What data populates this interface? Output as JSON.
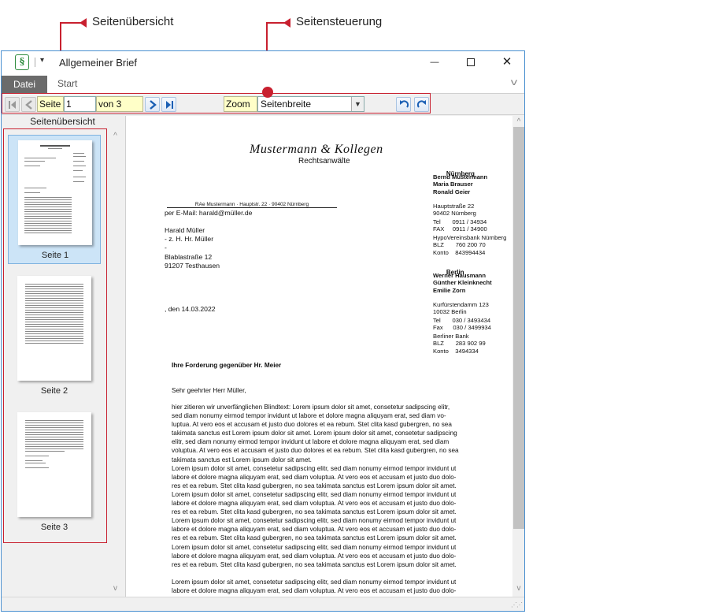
{
  "callouts": {
    "thumbnails_label": "Seitenübersicht",
    "navigation_label": "Seitensteuerung"
  },
  "window": {
    "title": "Allgemeiner Brief",
    "app_icon_glyph": "§",
    "qa_dropdown_glyph": "▾",
    "minimize_glyph": "—",
    "close_glyph": "✕"
  },
  "ribbon": {
    "tabs": [
      "Datei",
      "Start"
    ],
    "collapse_glyph": "v"
  },
  "toolbar": {
    "page_label": "Seite",
    "page_value": "1",
    "page_total": "von 3",
    "zoom_label": "Zoom",
    "zoom_value": "Seitenbreite",
    "dropdown_glyph": "▼"
  },
  "thumbnails": {
    "panel_title": "Seitenübersicht",
    "pages": [
      {
        "label": "Seite 1",
        "selected": true
      },
      {
        "label": "Seite 2",
        "selected": false
      },
      {
        "label": "Seite 3",
        "selected": false
      }
    ]
  },
  "scroll_glyphs": {
    "up": "^",
    "down": "v"
  },
  "letter": {
    "firm_name": "Mustermann & Kollegen",
    "firm_subtitle": "Rechtsanwälte",
    "return_address": "RAe Mustermann · Hauptstr. 22 · 90402 Nürnberg",
    "delivery": "per E-Mail: harald@müller.de",
    "recipient": "Harald Müller\n- z. H. Hr. Müller\n-\nBlablastraße 12\n91207 Testhausen",
    "date_line": ", den 14.03.2022",
    "subject": "Ihre Forderung gegenüber Hr. Meier",
    "salutation": "Sehr geehrter Herr Müller,",
    "body_1": "hier zitieren wir unverfänglichen Blindtext: Lorem ipsum dolor sit amet, consetetur sadipscing elitr,\nsed diam nonumy eirmod tempor invidunt ut labore et dolore magna aliquyam erat, sed diam vo-\nluptua. At vero eos et accusam et justo duo dolores et ea rebum. Stet clita kasd gubergren, no sea\ntakimata sanctus est Lorem ipsum dolor sit amet. Lorem ipsum dolor sit amet, consetetur sadipscing\nelitr, sed diam nonumy eirmod tempor invidunt ut labore et dolore magna aliquyam erat, sed diam\nvoluptua. At vero eos et accusam et justo duo dolores et ea rebum. Stet clita kasd gubergren, no sea\ntakimata sanctus est Lorem ipsum dolor sit amet.\nLorem ipsum dolor sit amet, consetetur sadipscing elitr, sed diam nonumy eirmod tempor invidunt ut\nlabore et dolore magna aliquyam erat, sed diam voluptua. At vero eos et accusam et justo duo dolo-\nres et ea rebum. Stet clita kasd gubergren, no sea takimata sanctus est Lorem ipsum dolor sit amet.\nLorem ipsum dolor sit amet, consetetur sadipscing elitr, sed diam nonumy eirmod tempor invidunt ut\nlabore et dolore magna aliquyam erat, sed diam voluptua. At vero eos et accusam et justo duo dolo-\nres et ea rebum. Stet clita kasd gubergren, no sea takimata sanctus est Lorem ipsum dolor sit amet.\nLorem ipsum dolor sit amet, consetetur sadipscing elitr, sed diam nonumy eirmod tempor invidunt ut\nlabore et dolore magna aliquyam erat, sed diam voluptua. At vero eos et accusam et justo duo dolo-\nres et ea rebum. Stet clita kasd gubergren, no sea takimata sanctus est Lorem ipsum dolor sit amet.\nLorem ipsum dolor sit amet, consetetur sadipscing elitr, sed diam nonumy eirmod tempor invidunt ut\nlabore et dolore magna aliquyam erat, sed diam voluptua. At vero eos et accusam et justo duo dolo-\nres et ea rebum. Stet clita kasd gubergren, no sea takimata sanctus est Lorem ipsum dolor sit amet.",
    "body_2": "Lorem ipsum dolor sit amet, consetetur sadipscing elitr, sed diam nonumy eirmod tempor invidunt ut\nlabore et dolore magna aliquyam erat, sed diam voluptua. At vero eos et accusam et justo duo dolo-",
    "sidebar_nuernberg": {
      "city": "Nürnberg",
      "names": "Bernd Mustermann\nMaria Brauser\nRonald Geier",
      "address": "Hauptstraße 22\n90402 Nürnberg",
      "contact": "Tel       0911 / 34934\nFAX     0911 / 34900",
      "bank": "HypoVereinsbank Nürnberg\nBLZ       760 200 70\nKonto    843994434"
    },
    "sidebar_berlin": {
      "city": "Berlin",
      "names": "Werner Hausmann\nGünther Kleinknecht\nEmilie Zorn",
      "address": "Kurfürstendamm 123\n10032 Berlin",
      "contact": "Tel       030 / 3493434\nFax      030 / 3499934",
      "bank": "Berliner Bank\nBLZ       283 902 99\nKonto    3494334"
    }
  },
  "colors": {
    "callout_red": "#c8202f",
    "label_yellow": "#ffffc8",
    "selection_blue": "#cce4f7",
    "window_border": "#4a90d0"
  }
}
